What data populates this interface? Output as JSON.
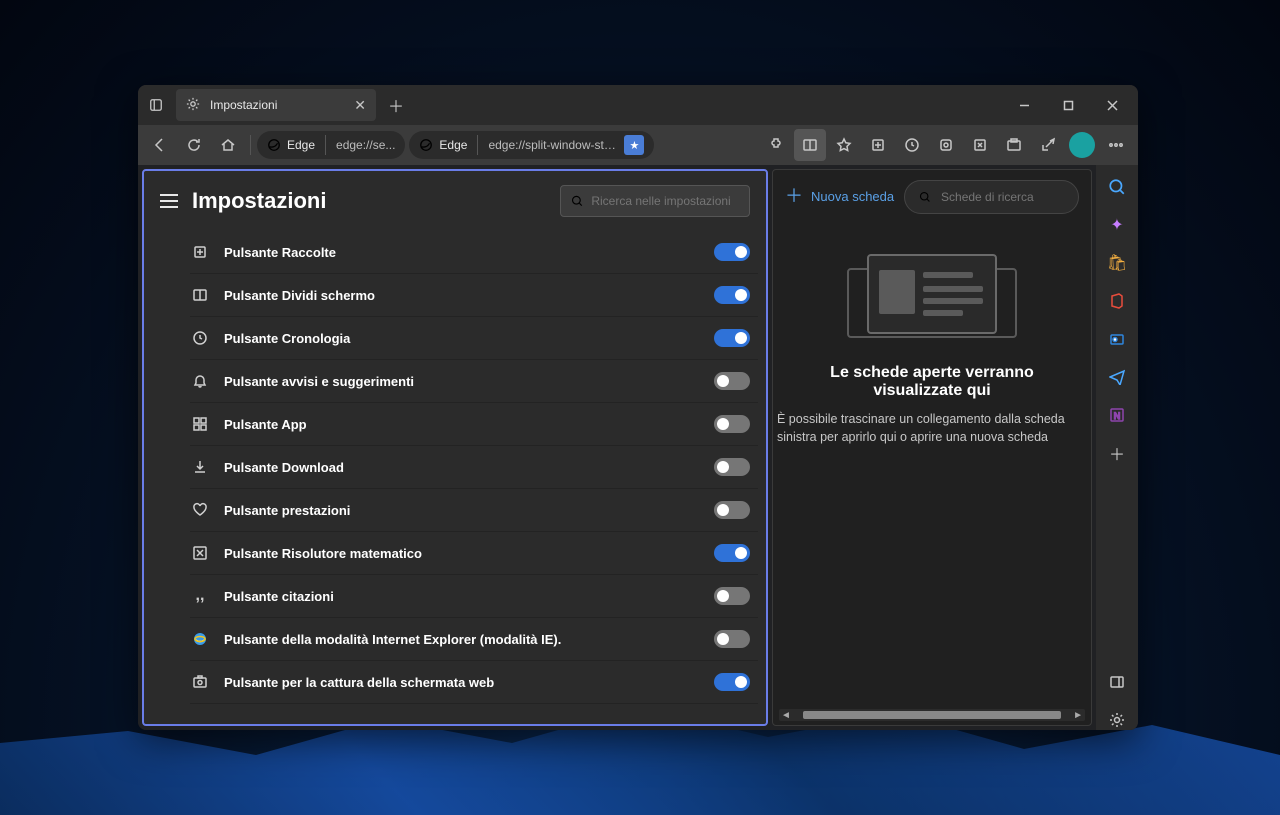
{
  "tab": {
    "title": "Impostazioni"
  },
  "address": {
    "left": {
      "brand": "Edge",
      "url": "edge://se..."
    },
    "right": {
      "brand": "Edge",
      "url": "edge://split-window-sta..."
    }
  },
  "settings": {
    "title": "Impostazioni",
    "search_placeholder": "Ricerca nelle impostazioni",
    "items": [
      {
        "label": "Pulsante Raccolte",
        "on": true,
        "icon": "collections"
      },
      {
        "label": "Pulsante Dividi schermo",
        "on": true,
        "icon": "split"
      },
      {
        "label": "Pulsante Cronologia",
        "on": true,
        "icon": "history"
      },
      {
        "label": "Pulsante avvisi e suggerimenti",
        "on": false,
        "icon": "bell"
      },
      {
        "label": "Pulsante App",
        "on": false,
        "icon": "apps"
      },
      {
        "label": "Pulsante Download",
        "on": false,
        "icon": "download"
      },
      {
        "label": "Pulsante prestazioni",
        "on": false,
        "icon": "heart"
      },
      {
        "label": "Pulsante Risolutore matematico",
        "on": true,
        "icon": "math"
      },
      {
        "label": "Pulsante citazioni",
        "on": false,
        "icon": "quote"
      },
      {
        "label": "Pulsante della modalità Internet Explorer (modalità IE).",
        "on": false,
        "icon": "ie"
      },
      {
        "label": "Pulsante per la cattura della schermata web",
        "on": true,
        "icon": "capture"
      }
    ]
  },
  "split": {
    "new_tab": "Nuova scheda",
    "search_placeholder": "Schede di ricerca",
    "heading": "Le schede aperte verranno visualizzate qui",
    "sub": "È possibile trascinare un collegamento dalla scheda sinistra per aprirlo qui o aprire una nuova scheda"
  }
}
